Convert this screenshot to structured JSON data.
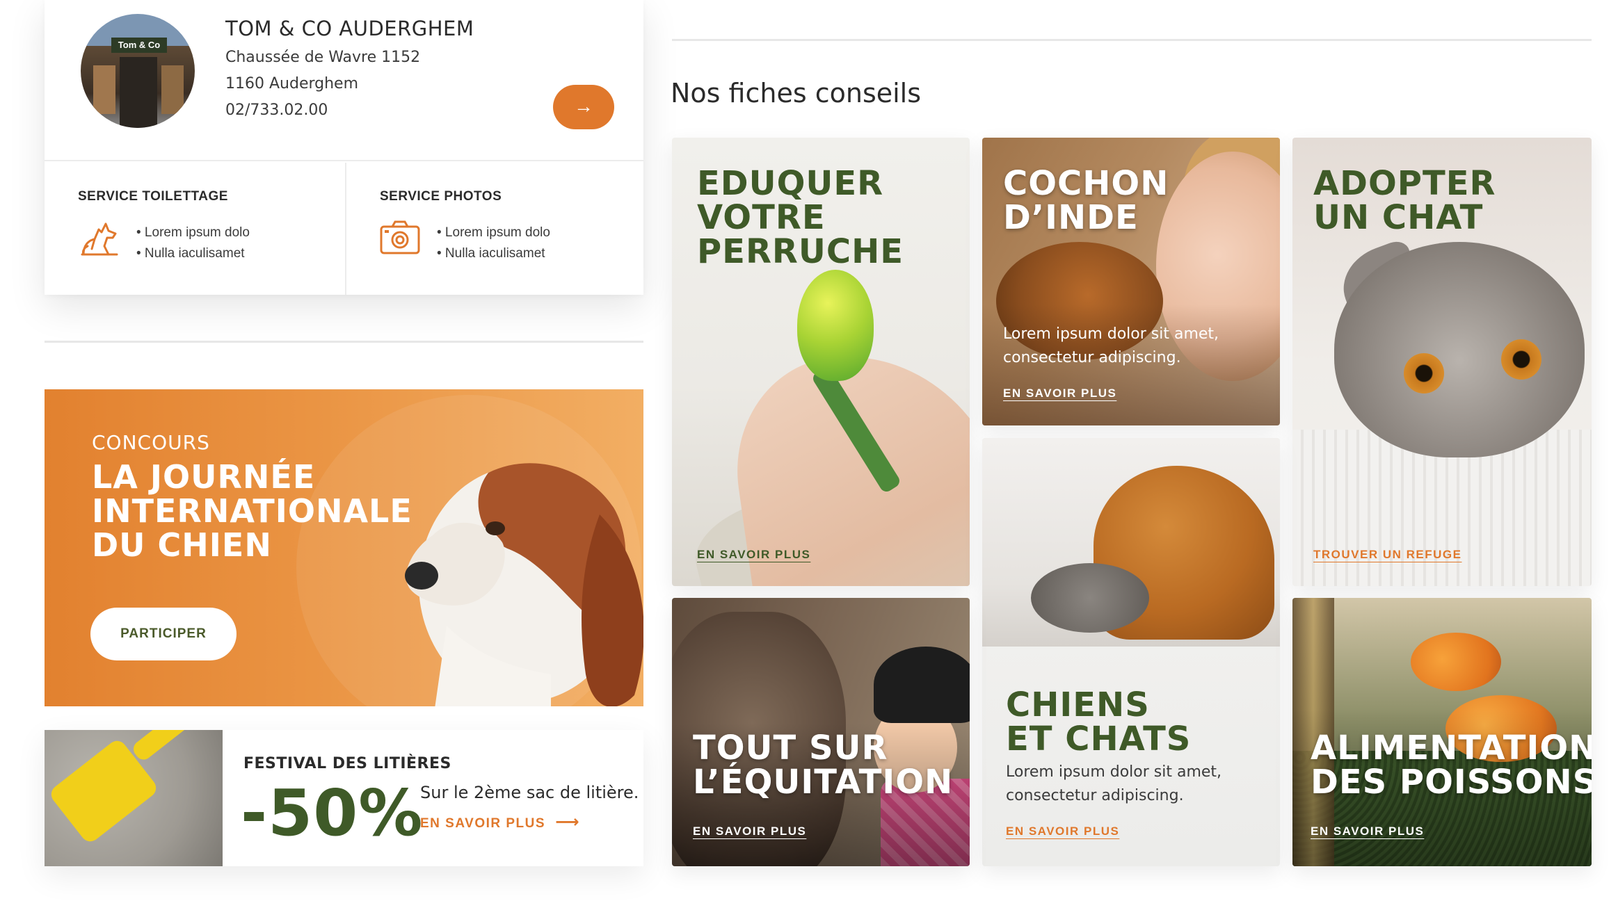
{
  "store": {
    "name": "TOM & CO AUDERGHEM",
    "street": "Chaussée de Wavre 1152",
    "city": "1160 Auderghem",
    "phone": "02/733.02.00",
    "avatar_sign": "Tom & Co",
    "arrow_icon": "arrow-right-icon"
  },
  "services": [
    {
      "title": "SERVICE TOILETTAGE",
      "icon": "dog-icon",
      "bullets": [
        "• Lorem ipsum dolo",
        "• Nulla iaculisamet"
      ]
    },
    {
      "title": "SERVICE PHOTOS",
      "icon": "camera-icon",
      "bullets": [
        "• Lorem ipsum dolo",
        "• Nulla iaculisamet"
      ]
    }
  ],
  "promo": {
    "kicker": "CONCOURS",
    "title_lines": [
      "LA JOURNÉE",
      "INTERNATIONALE",
      "DU CHIEN"
    ],
    "button": "PARTICIPER"
  },
  "litter": {
    "title": "FESTIVAL DES LITIÈRES",
    "discount": "-50%",
    "description": "Sur le 2ème sac de litière.",
    "link": "EN SAVOIR PLUS"
  },
  "tips": {
    "section_title": "Nos fiches conseils",
    "tiles": [
      {
        "title_lines": [
          "EDUQUER",
          "VOTRE",
          "PERRUCHE"
        ],
        "link": "EN SAVOIR PLUS"
      },
      {
        "title_lines": [
          "COCHON",
          "D’INDE"
        ],
        "text": "Lorem ipsum dolor sit amet, consectetur adipiscing.",
        "link": "EN SAVOIR PLUS"
      },
      {
        "title_lines": [
          "ADOPTER",
          "UN CHAT"
        ],
        "link": "TROUVER UN REFUGE"
      },
      {
        "title_lines": [
          "CHIENS",
          "ET CHATS"
        ],
        "text": "Lorem ipsum dolor sit amet, consectetur adipiscing.",
        "link": "EN SAVOIR PLUS"
      },
      {
        "title_lines": [
          "TOUT SUR",
          "L’ÉQUITATION"
        ],
        "link": "EN SAVOIR PLUS"
      },
      {
        "title_lines": [
          "ALIMENTATION",
          "DES POISSONS"
        ],
        "link": "EN SAVOIR PLUS"
      }
    ]
  },
  "colors": {
    "accent_orange": "#e0782c",
    "title_green": "#3f5a28"
  }
}
